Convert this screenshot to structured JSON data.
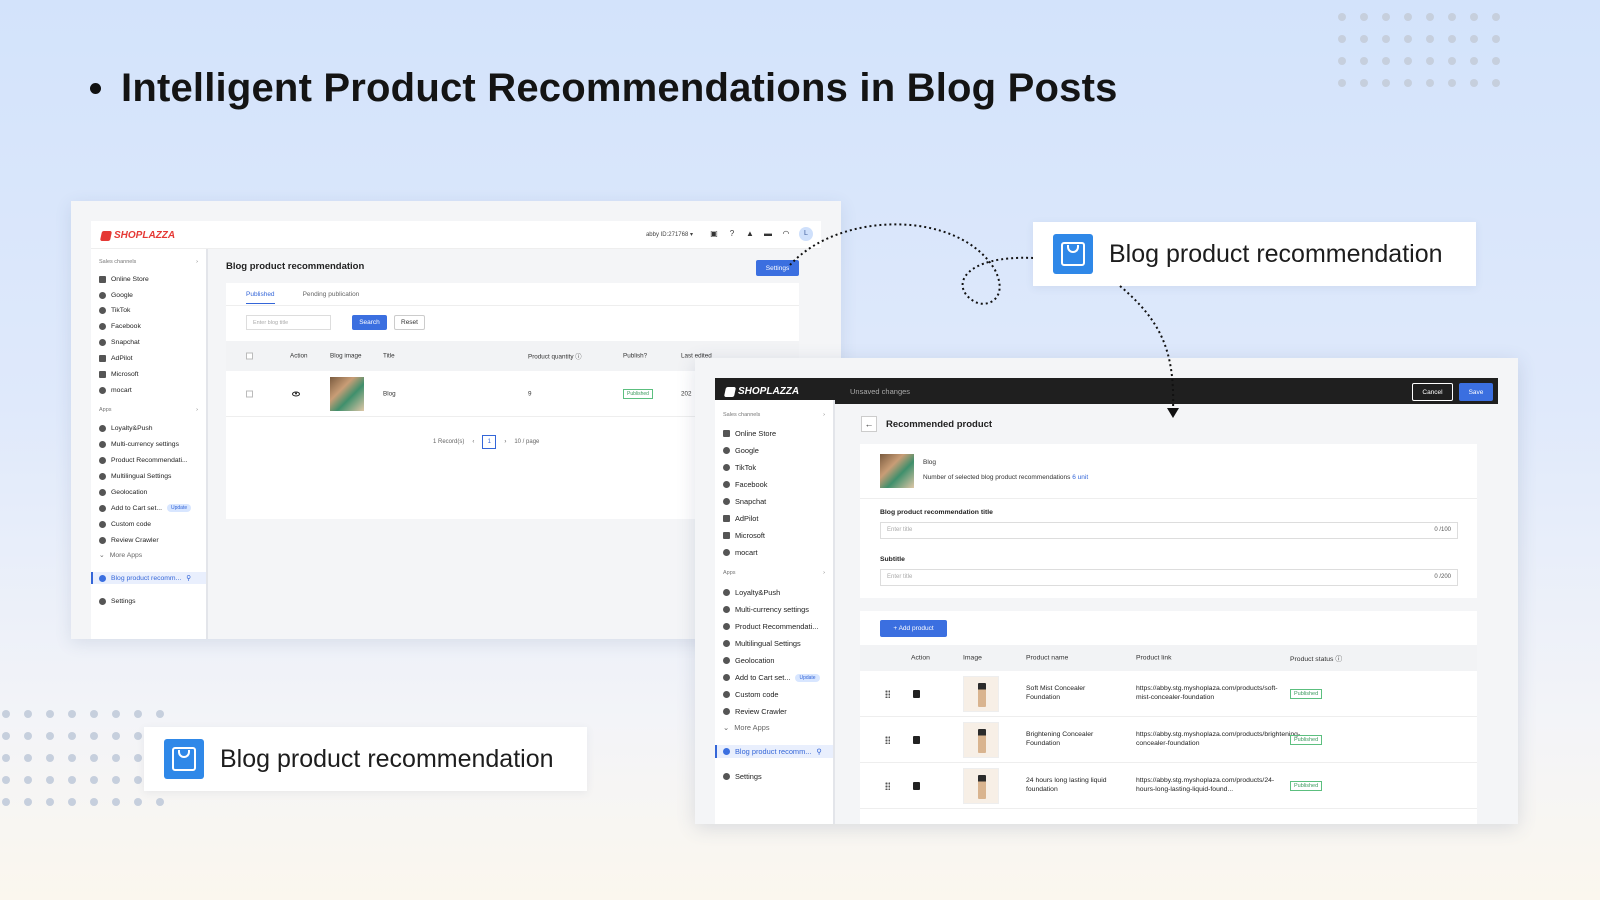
{
  "headline": "Intelligent Product Recommendations in Blog Posts",
  "callouts": {
    "top": "Blog product recommendation",
    "bottom": "Blog product recommendation"
  },
  "colors": {
    "accent": "#3b6fe0",
    "brand": "#e53935",
    "bag": "#2f88e8",
    "published": "#3a9a5c"
  },
  "logo": "SHOPLAZZA",
  "screen1": {
    "user": "abby ID:271768 ▾",
    "avatar": "L",
    "title": "Blog product recommendation",
    "settings_label": "Settings",
    "tabs": [
      "Published",
      "Pending publication"
    ],
    "search_placeholder": "Enter blog title",
    "search_label": "Search",
    "reset_label": "Reset",
    "columns": [
      "Action",
      "Blog image",
      "Title",
      "Product quantity",
      "Publish?",
      "Last edited"
    ],
    "row": {
      "title": "Blog",
      "quantity": "9",
      "status": "Published",
      "edited": "202"
    },
    "pager": {
      "records": "1 Record(s)",
      "page": "1",
      "per_page": "10 / page"
    }
  },
  "sidebar": {
    "sales_channels": "Sales channels",
    "channels": [
      "Online Store",
      "Google",
      "TikTok",
      "Facebook",
      "Snapchat",
      "AdPilot",
      "Microsoft",
      "mocart"
    ],
    "apps_label": "Apps",
    "apps": [
      "Loyalty&Push",
      "Multi-currency settings",
      "Product Recommendati...",
      "Multilingual Settings",
      "Geolocation",
      "Add to Cart set...",
      "Custom code",
      "Review Crawler"
    ],
    "update_badge": "Update",
    "more_apps": "More Apps",
    "active_item": "Blog product recomm...",
    "settings": "Settings"
  },
  "screen2": {
    "unsaved": "Unsaved changes",
    "cancel_label": "Cancel",
    "save_label": "Save",
    "title": "Recommended product",
    "blog_name": "Blog",
    "count_text": "Number of selected blog product recommendations",
    "count_value": "6 unit",
    "title_label": "Blog product recommendation title",
    "title_placeholder": "Enter title",
    "title_counter": "0 /100",
    "subtitle_label": "Subtitle",
    "subtitle_placeholder": "Enter title",
    "subtitle_counter": "0 /200",
    "add_product_label": "+ Add product",
    "columns": [
      "Action",
      "Image",
      "Product name",
      "Product link",
      "Product status"
    ],
    "products": [
      {
        "name": "Soft Mist Concealer Foundation",
        "link": "https://abby.stg.myshoplaza.com/products/soft-mist-concealer-foundation",
        "status": "Published"
      },
      {
        "name": "Brightening Concealer Foundation",
        "link": "https://abby.stg.myshoplaza.com/products/brightening-concealer-foundation",
        "status": "Published"
      },
      {
        "name": "24 hours long lasting liquid foundation",
        "link": "https://abby.stg.myshoplaza.com/products/24-hours-long-lasting-liquid-found...",
        "status": "Published"
      }
    ]
  }
}
